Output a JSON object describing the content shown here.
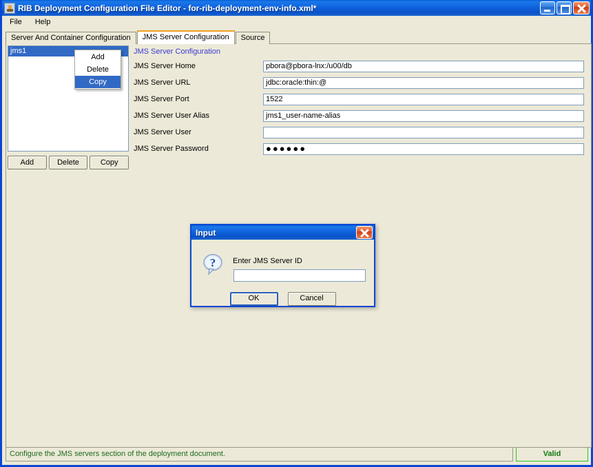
{
  "window": {
    "title": "RIB Deployment Configuration File Editor - for-rib-deployment-env-info.xml*",
    "icon": "app-coffee-icon",
    "buttons": {
      "minimize": "minimize-icon",
      "maximize": "maximize-icon",
      "close": "close-icon"
    }
  },
  "menubar": {
    "items": [
      {
        "label": "File"
      },
      {
        "label": "Help"
      }
    ]
  },
  "tabs": [
    {
      "label": "Server And Container Configuration",
      "active": false
    },
    {
      "label": "JMS Server Configuration",
      "active": true
    },
    {
      "label": "Source",
      "active": false
    }
  ],
  "list_panel": {
    "items": [
      {
        "label": "jms1",
        "selected": true
      }
    ],
    "buttons": [
      {
        "label": "Add"
      },
      {
        "label": "Delete"
      },
      {
        "label": "Copy"
      }
    ]
  },
  "context_menu": {
    "items": [
      {
        "label": "Add",
        "highlighted": false
      },
      {
        "label": "Delete",
        "highlighted": false
      },
      {
        "label": "Copy",
        "highlighted": true
      }
    ]
  },
  "form": {
    "title": "JMS Server Configuration",
    "rows": [
      {
        "label": "JMS Server Home",
        "value": "pbora@pbora-lnx:/u00/db",
        "placeholder": "",
        "type": "text"
      },
      {
        "label": "JMS Server URL",
        "value": "jdbc:oracle:thin:@",
        "placeholder": "",
        "type": "text"
      },
      {
        "label": "JMS Server Port",
        "value": "1522",
        "placeholder": "",
        "type": "text"
      },
      {
        "label": "JMS Server User Alias",
        "value": "jms1_user-name-alias",
        "placeholder": "",
        "type": "text"
      },
      {
        "label": "JMS Server User",
        "value": "",
        "placeholder": "",
        "type": "text"
      },
      {
        "label": "JMS Server Password",
        "value": "●●●●●●",
        "placeholder": "",
        "type": "password"
      }
    ]
  },
  "dialog": {
    "title": "Input",
    "icon": "question-bubble-icon",
    "close_icon": "close-icon",
    "prompt": "Enter JMS Server ID",
    "input_value": "",
    "input_placeholder": "",
    "buttons": [
      {
        "label": "OK",
        "default": true
      },
      {
        "label": "Cancel",
        "default": false
      }
    ]
  },
  "statusbar": {
    "message": "Configure the JMS servers section of the deployment document.",
    "badge": "Valid"
  },
  "colors": {
    "title_blue": "#0a52c8",
    "window_border": "#0a46d4",
    "panel_bg": "#ece9d8",
    "selection_blue": "#316ac5",
    "active_tab_accent": "#f0a020",
    "valid_green": "#22cc22",
    "status_text_green": "#1d6b1d",
    "form_title_blue": "#3a3ad2"
  }
}
